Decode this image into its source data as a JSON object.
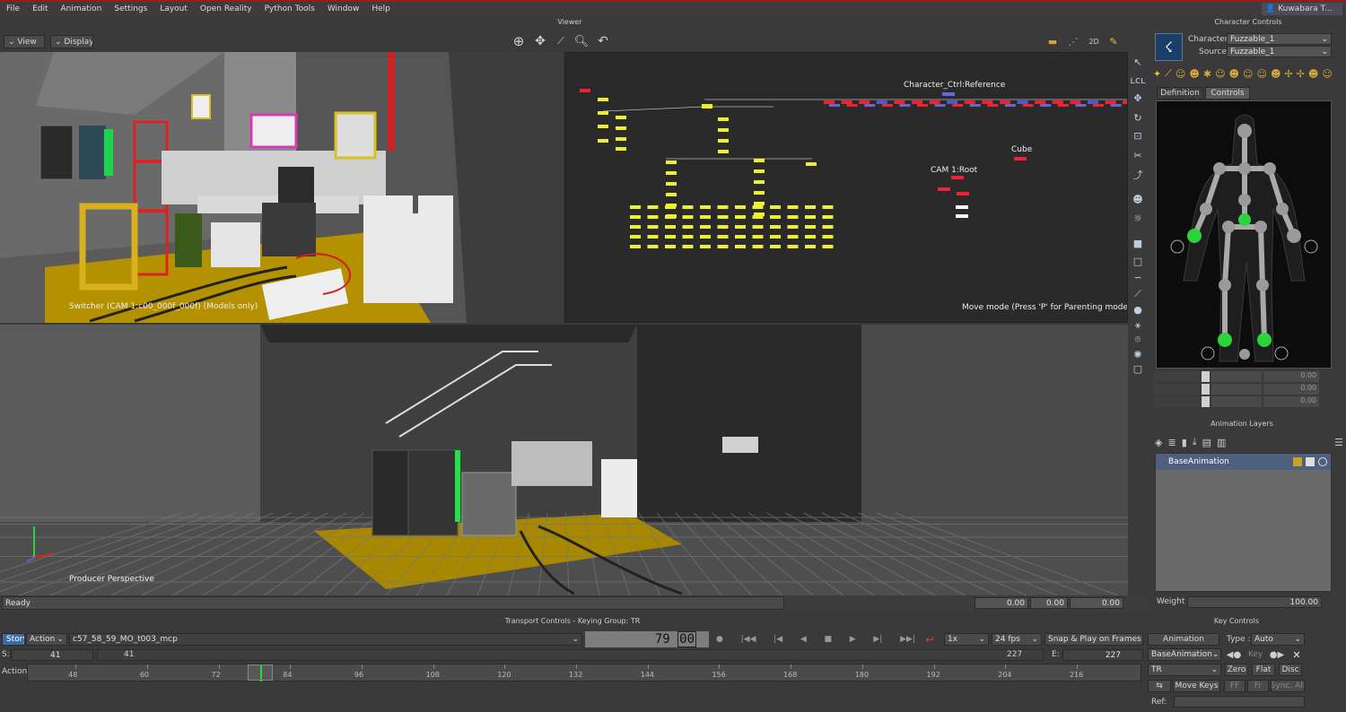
{
  "menubar": {
    "items": [
      "File",
      "Edit",
      "Animation",
      "Settings",
      "Layout",
      "Open Reality",
      "Python Tools",
      "Window",
      "Help"
    ],
    "user": "Kuwabara T..."
  },
  "viewer": {
    "title": "Viewer",
    "view_btn": "View",
    "display_btn": "Display",
    "top_left_caption": "Switcher (CAM 1:c00_000f_000f) (Models only)",
    "schematic": {
      "reference": "Character_Ctrl:Reference",
      "cube": "Cube",
      "cam_root": "CAM 1:Root",
      "mode_hint": "Move mode (Press 'P' for Parenting mode)"
    },
    "bottom_caption": "Producer Perspective"
  },
  "status": {
    "text": "Ready",
    "fields": [
      "0.00",
      "0.00",
      "0.00"
    ]
  },
  "character_controls": {
    "title": "Character Controls",
    "character_label": "Character",
    "character_value": "Fuzzable_1",
    "source_label": "Source",
    "source_value": "Fuzzable_1",
    "tabs": [
      "Definition",
      "Controls"
    ],
    "rows": [
      "0.00",
      "0.00",
      "0.00"
    ]
  },
  "animation_layers": {
    "title": "Animation Layers",
    "layer": "BaseAnimation",
    "weight_label": "Weight",
    "weight_value": "100.00"
  },
  "transport": {
    "title": "Transport Controls  -  Keying Group: TR",
    "story_btn": "Story",
    "action_mode": "Action",
    "take": "c57_58_59_MO_t003_mcp",
    "frame": "79",
    "frame_fraction": "00",
    "speed": "1x",
    "fps": "24 fps",
    "snap": "Snap & Play on Frames",
    "start_label": "S:",
    "start_value": "41",
    "start_value2": "41",
    "end_value": "227",
    "end_label": "E:",
    "end_value2": "227",
    "action_label": "Action",
    "ticks": [
      "48",
      "60",
      "72",
      "84",
      "96",
      "108",
      "120",
      "132",
      "144",
      "156",
      "168",
      "180",
      "192",
      "204",
      "216"
    ]
  },
  "key_controls": {
    "title": "Key Controls",
    "animation_btn": "Animation",
    "type_label": "Type :",
    "type_value": "Auto",
    "layer": "BaseAnimation",
    "key_btn": "Key",
    "group": "TR",
    "zero_btn": "Zero",
    "flat_btn": "Flat",
    "disc_btn": "Disc",
    "move_keys_btn": "Move Keys",
    "ff_btn": "FF",
    "fr_btn": "Fr",
    "sync_btn": "Sync. All",
    "ref_label": "Ref:"
  }
}
